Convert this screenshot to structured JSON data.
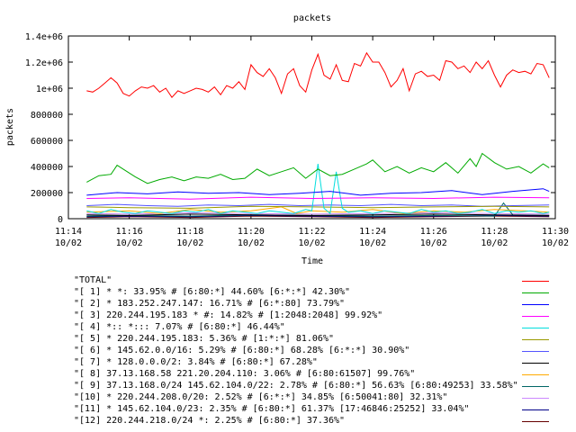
{
  "chart_data": {
    "type": "line",
    "title": "packets",
    "xlabel": "Time",
    "ylabel": "packets",
    "ylim": [
      0,
      1400000
    ],
    "yticks": [
      {
        "value": 0,
        "label": "0"
      },
      {
        "value": 200000,
        "label": "200000"
      },
      {
        "value": 400000,
        "label": "400000"
      },
      {
        "value": 600000,
        "label": "600000"
      },
      {
        "value": 800000,
        "label": "800000"
      },
      {
        "value": 1000000,
        "label": "1e+06"
      },
      {
        "value": 1200000,
        "label": "1.2e+06"
      },
      {
        "value": 1400000,
        "label": "1.4e+06"
      }
    ],
    "xlim": [
      0,
      16
    ],
    "xticks": [
      {
        "value": 0,
        "time": "11:14",
        "date": "10/02"
      },
      {
        "value": 2,
        "time": "11:16",
        "date": "10/02"
      },
      {
        "value": 4,
        "time": "11:18",
        "date": "10/02"
      },
      {
        "value": 6,
        "time": "11:20",
        "date": "10/02"
      },
      {
        "value": 8,
        "time": "11:22",
        "date": "10/02"
      },
      {
        "value": 10,
        "time": "11:24",
        "date": "10/02"
      },
      {
        "value": 12,
        "time": "11:26",
        "date": "10/02"
      },
      {
        "value": 14,
        "time": "11:28",
        "date": "10/02"
      },
      {
        "value": 16,
        "time": "11:30",
        "date": "10/02"
      }
    ],
    "grid": false,
    "legend_position": "bottom",
    "series": [
      {
        "name": "\"TOTAL\"",
        "color": "#ff0000",
        "x": [
          0.6,
          0.8,
          1,
          1.2,
          1.4,
          1.6,
          1.8,
          2,
          2.2,
          2.4,
          2.6,
          2.8,
          3,
          3.2,
          3.4,
          3.6,
          3.8,
          4,
          4.2,
          4.4,
          4.6,
          4.8,
          5,
          5.2,
          5.4,
          5.6,
          5.8,
          6,
          6.2,
          6.4,
          6.6,
          6.8,
          7,
          7.2,
          7.4,
          7.6,
          7.8,
          8,
          8.2,
          8.4,
          8.6,
          8.8,
          9,
          9.2,
          9.4,
          9.6,
          9.8,
          10,
          10.2,
          10.4,
          10.6,
          10.8,
          11,
          11.2,
          11.4,
          11.6,
          11.8,
          12,
          12.2,
          12.4,
          12.6,
          12.8,
          13,
          13.2,
          13.4,
          13.6,
          13.8,
          14,
          14.2,
          14.4,
          14.6,
          14.8,
          15,
          15.2,
          15.4,
          15.6,
          15.8
        ],
        "values": [
          980000,
          970000,
          1000000,
          1040000,
          1080000,
          1040000,
          960000,
          940000,
          980000,
          1010000,
          1000000,
          1020000,
          970000,
          1000000,
          930000,
          980000,
          960000,
          980000,
          1000000,
          990000,
          970000,
          1010000,
          950000,
          1020000,
          1000000,
          1050000,
          990000,
          1180000,
          1120000,
          1090000,
          1150000,
          1080000,
          960000,
          1110000,
          1150000,
          1020000,
          970000,
          1140000,
          1260000,
          1100000,
          1070000,
          1180000,
          1060000,
          1050000,
          1190000,
          1170000,
          1270000,
          1200000,
          1200000,
          1120000,
          1010000,
          1060000,
          1150000,
          980000,
          1110000,
          1130000,
          1090000,
          1100000,
          1060000,
          1210000,
          1200000,
          1150000,
          1170000,
          1120000,
          1200000,
          1150000,
          1210000,
          1100000,
          1010000,
          1100000,
          1140000,
          1120000,
          1130000,
          1110000,
          1190000,
          1180000,
          1080000
        ]
      },
      {
        "name": "\"[ 1] * *: 33.95% # [6:80:*] 44.60% [6:*:*] 42.30%\"",
        "color": "#00aa00",
        "x": [
          0.6,
          1,
          1.4,
          1.6,
          1.8,
          2.2,
          2.6,
          3,
          3.4,
          3.8,
          4.2,
          4.6,
          5,
          5.4,
          5.8,
          6.2,
          6.6,
          7,
          7.4,
          7.8,
          8.2,
          8.6,
          9,
          9.4,
          9.8,
          10,
          10.4,
          10.8,
          11.2,
          11.6,
          12,
          12.4,
          12.8,
          13.2,
          13.4,
          13.6,
          14,
          14.4,
          14.8,
          15.2,
          15.6,
          15.8
        ],
        "values": [
          280000,
          330000,
          340000,
          410000,
          380000,
          320000,
          270000,
          300000,
          320000,
          290000,
          320000,
          310000,
          340000,
          300000,
          310000,
          380000,
          330000,
          360000,
          390000,
          310000,
          380000,
          330000,
          340000,
          380000,
          420000,
          450000,
          360000,
          400000,
          350000,
          390000,
          360000,
          430000,
          350000,
          460000,
          400000,
          500000,
          430000,
          380000,
          400000,
          350000,
          420000,
          390000
        ]
      },
      {
        "name": "\"[ 2] * 183.252.247.147: 16.71% # [6:*:80] 73.79%\"",
        "color": "#0000ff",
        "x": [
          0.6,
          1.6,
          2.6,
          3.6,
          4.6,
          5.6,
          6.6,
          7.6,
          8.6,
          9.6,
          10.6,
          11.6,
          12.6,
          13.6,
          14.6,
          15.6,
          15.8
        ],
        "values": [
          180000,
          200000,
          190000,
          205000,
          195000,
          200000,
          185000,
          195000,
          210000,
          180000,
          195000,
          200000,
          215000,
          185000,
          210000,
          230000,
          210000
        ]
      },
      {
        "name": "\"[ 3] 220.244.195.183 * #: 14.82% # [1:2048:2048] 99.92%\"",
        "color": "#ff00ff",
        "x": [
          0.6,
          2,
          4,
          6,
          8,
          10,
          12,
          14,
          15.8
        ],
        "values": [
          155000,
          160000,
          150000,
          165000,
          155000,
          160000,
          155000,
          165000,
          160000
        ]
      },
      {
        "name": "\"[ 4] *:: *::: 7.07% # [6:80:*] 46.44%\"",
        "color": "#00dddd",
        "x": [
          0.6,
          1,
          1.4,
          1.8,
          2.2,
          2.6,
          3,
          3.4,
          3.8,
          4.2,
          4.6,
          5,
          5.4,
          5.8,
          6.2,
          6.6,
          7,
          7.4,
          7.8,
          8,
          8.2,
          8.4,
          8.6,
          8.8,
          9,
          9.2,
          9.6,
          10,
          10.4,
          10.8,
          11.2,
          11.6,
          12,
          12.4,
          12.8,
          13.2,
          13.6,
          14,
          14.4,
          14.8,
          15.2,
          15.6,
          15.8
        ],
        "values": [
          60000,
          40000,
          70000,
          50000,
          40000,
          60000,
          50000,
          40000,
          60000,
          50000,
          70000,
          40000,
          60000,
          50000,
          40000,
          60000,
          50000,
          40000,
          70000,
          60000,
          420000,
          80000,
          40000,
          360000,
          80000,
          50000,
          60000,
          40000,
          60000,
          50000,
          40000,
          70000,
          50000,
          60000,
          40000,
          50000,
          70000,
          40000,
          60000,
          50000,
          60000,
          40000,
          50000
        ]
      },
      {
        "name": "\"[ 5] * 220.244.195.183: 5.36% # [1:*:*] 81.06%\"",
        "color": "#999900",
        "x": [
          0.6,
          2,
          4,
          6,
          8,
          10,
          12,
          14,
          15.8
        ],
        "values": [
          90000,
          85000,
          80000,
          95000,
          90000,
          85000,
          90000,
          95000,
          90000
        ]
      },
      {
        "name": "\"[ 6] * 145.62.0.0/16: 5.29% # [6:80:*] 68.28% [6:*:*] 30.90%\"",
        "color": "#5555ff",
        "x": [
          0.6,
          1.6,
          2.6,
          3.6,
          4.6,
          5.6,
          6.6,
          7.6,
          8.6,
          9.6,
          10.6,
          11.6,
          12.6,
          13.6,
          14.6,
          15.8
        ],
        "values": [
          100000,
          110000,
          100000,
          95000,
          105000,
          100000,
          110000,
          100000,
          105000,
          100000,
          110000,
          100000,
          105000,
          95000,
          100000,
          105000
        ]
      },
      {
        "name": "\"[ 7] * 128.0.0.0/2: 3.84% # [6:80:*] 67.28%\"",
        "color": "#000000",
        "x": [
          0.6,
          2,
          4,
          6,
          8,
          10,
          12,
          14,
          15.8
        ],
        "values": [
          30000,
          25000,
          35000,
          30000,
          25000,
          30000,
          35000,
          30000,
          25000
        ]
      },
      {
        "name": "\"[ 8] 37.13.168.58 221.20.204.110: 3.06% # [6:80:61507] 99.76%\"",
        "color": "#ffaa00",
        "x": [
          0.6,
          2,
          3,
          4,
          5,
          6,
          7,
          7.5,
          8,
          9,
          10,
          11,
          12,
          13,
          14,
          15,
          15.8
        ],
        "values": [
          50000,
          60000,
          40000,
          70000,
          50000,
          60000,
          90000,
          40000,
          60000,
          50000,
          70000,
          40000,
          60000,
          50000,
          70000,
          60000,
          50000
        ]
      },
      {
        "name": "\"[ 9] 37.13.168.0/24 145.62.104.0/22: 2.78% # [6:80:*] 56.63% [6:80:49253] 33.58%\"",
        "color": "#006666",
        "x": [
          0.6,
          2,
          4,
          6,
          8,
          10,
          12,
          14,
          14.3,
          14.6,
          15.8
        ],
        "values": [
          20000,
          25000,
          20000,
          30000,
          25000,
          20000,
          25000,
          20000,
          120000,
          30000,
          25000
        ]
      },
      {
        "name": "\"[10] * 220.244.208.0/20: 2.52% # [6:*:*] 34.85% [6:50041:80] 32.31%\"",
        "color": "#cc88ff",
        "x": [
          0.6,
          2,
          4,
          6,
          8,
          10,
          12,
          14,
          15.8
        ],
        "values": [
          40000,
          35000,
          45000,
          40000,
          35000,
          40000,
          45000,
          40000,
          35000
        ]
      },
      {
        "name": "\"[11] * 145.62.104.0/23: 2.35% # [6:80:*] 61.37% [17:46846:25252] 33.04%\"",
        "color": "#000088",
        "x": [
          0.6,
          2,
          4,
          6,
          8,
          10,
          12,
          14,
          15.8
        ],
        "values": [
          15000,
          20000,
          15000,
          25000,
          20000,
          15000,
          20000,
          25000,
          20000
        ]
      },
      {
        "name": "\"[12] 220.244.218.0/24 *: 2.25% # [6:80:*] 37.36%\"",
        "color": "#660000",
        "x": [
          0.6,
          2,
          4,
          6,
          8,
          10,
          12,
          14,
          15.8
        ],
        "values": [
          10000,
          15000,
          10000,
          20000,
          15000,
          10000,
          15000,
          20000,
          15000
        ]
      }
    ]
  }
}
